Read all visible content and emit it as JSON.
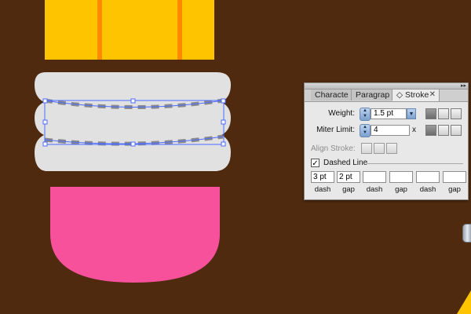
{
  "colors": {
    "background": "#4f2a0f",
    "pencil_body": "#ffc400",
    "pencil_stripe": "#ff8a00",
    "ferrule": "#e1e1e1",
    "eraser": "#f7519b",
    "dash_stroke": "#8a8a8a",
    "selection": "#4b6bff"
  },
  "panel": {
    "tabs": [
      {
        "label": "Characte"
      },
      {
        "label": "Paragrap"
      },
      {
        "label": "Stroke",
        "prefix": "◇",
        "close": "✕"
      }
    ],
    "menu_icon": "▸▸",
    "weight": {
      "label": "Weight:",
      "value": "1.5 pt"
    },
    "miter": {
      "label": "Miter Limit:",
      "value": "4",
      "unit": "x"
    },
    "align_stroke": {
      "label": "Align Stroke:"
    },
    "dashed_line": {
      "label": "Dashed Line",
      "checked": true
    },
    "dash_cells": [
      {
        "value": "3 pt",
        "caption": "dash"
      },
      {
        "value": "2 pt",
        "caption": "gap"
      },
      {
        "value": "",
        "caption": "dash"
      },
      {
        "value": "",
        "caption": "gap"
      },
      {
        "value": "",
        "caption": "dash"
      },
      {
        "value": "",
        "caption": "gap"
      }
    ]
  },
  "icons": {
    "stepper": "stepper-arrows-icon",
    "dropdown": "chevron-down-icon",
    "check": "✓"
  }
}
